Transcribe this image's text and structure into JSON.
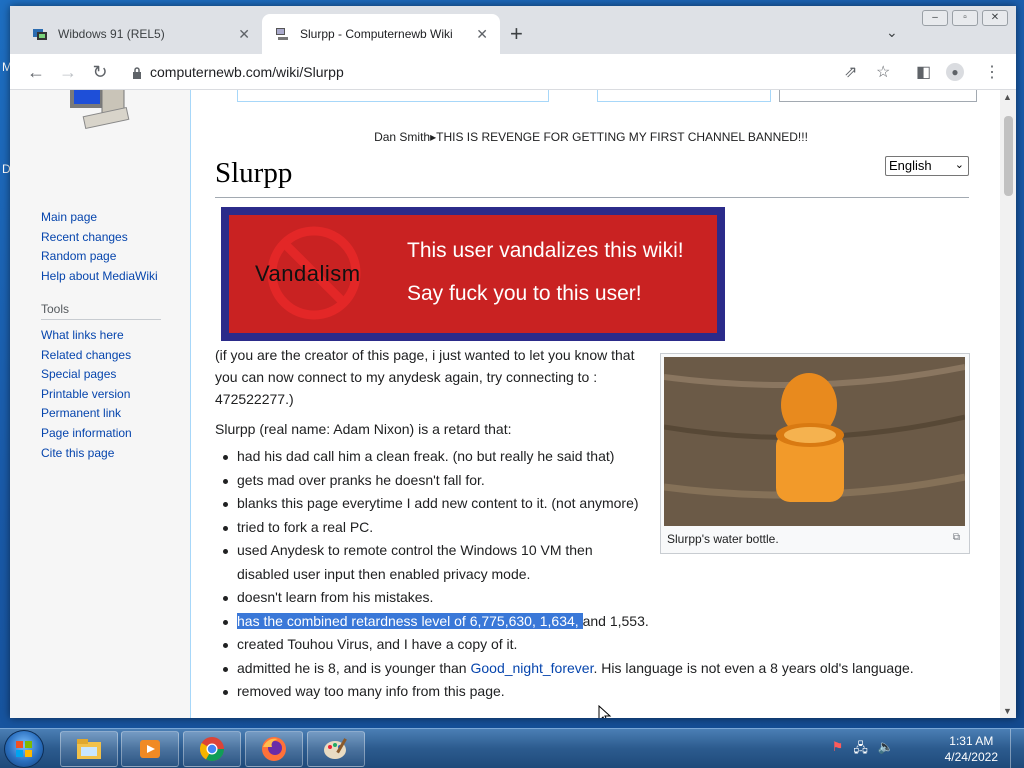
{
  "browser": {
    "tabs": [
      {
        "title": "Wibdows 91 (REL5)",
        "active": false
      },
      {
        "title": "Slurpp - Computernewb Wiki",
        "active": true
      }
    ],
    "url": "computernewb.com/wiki/Slurpp"
  },
  "sidebar": {
    "navigation": [
      {
        "label": "Main page"
      },
      {
        "label": "Recent changes"
      },
      {
        "label": "Random page"
      },
      {
        "label": "Help about MediaWiki"
      }
    ],
    "tools_heading": "Tools",
    "tools": [
      {
        "label": "What links here"
      },
      {
        "label": "Related changes"
      },
      {
        "label": "Special pages"
      },
      {
        "label": "Printable version"
      },
      {
        "label": "Permanent link"
      },
      {
        "label": "Page information"
      },
      {
        "label": "Cite this page"
      }
    ]
  },
  "page": {
    "sitenotice": "Dan Smith▸THIS IS REVENGE FOR GETTING MY FIRST CHANNEL BANNED!!!",
    "title": "Slurpp",
    "language": "English",
    "banner": {
      "sign_text": "Vandalism",
      "line1": "This user vandalizes this wiki!",
      "line2": "Say fuck you to this user!"
    },
    "intro_lines": [
      "(if you are the creator of this page, i just wanted to let you know that",
      "you can now connect to my anydesk again, try connecting to :",
      "472522277.)"
    ],
    "lead": "Slurpp (real name: Adam Nixon) is a retard that:",
    "image_caption": "Slurpp's water bottle.",
    "items": [
      {
        "text": "had his dad call him a clean freak. (no but really he said that)"
      },
      {
        "text": "gets mad over pranks he doesn't fall for."
      },
      {
        "text": "blanks this page everytime I add new content to it. (not anymore)"
      },
      {
        "text": "tried to fork a real PC."
      },
      {
        "text": "used Anydesk to remote control the Windows 10 VM then"
      },
      {
        "text": "disabled user input then enabled privacy mode."
      },
      {
        "text": "doesn't learn from his mistakes."
      },
      {
        "highlighted": "has the combined retardness level of 6,775,630, 1,634, ",
        "rest": "and 1,553."
      },
      {
        "text": "created Touhou Virus, and I have a copy of it."
      },
      {
        "before": "admitted he is 8, and is younger than ",
        "link": "Good_night_forever",
        "after": ". His language is not even a 8 years old's language."
      },
      {
        "text": "removed way too many info from this page."
      }
    ]
  },
  "taskbar": {
    "time": "1:31 AM",
    "date": "4/24/2022",
    "pinned": [
      "file-explorer",
      "media-player",
      "chrome",
      "firefox",
      "paint"
    ]
  },
  "colors": {
    "banner_red": "#c92222",
    "banner_border": "#2b2b8a",
    "selection": "#3a78d8",
    "link": "#0645ad"
  }
}
